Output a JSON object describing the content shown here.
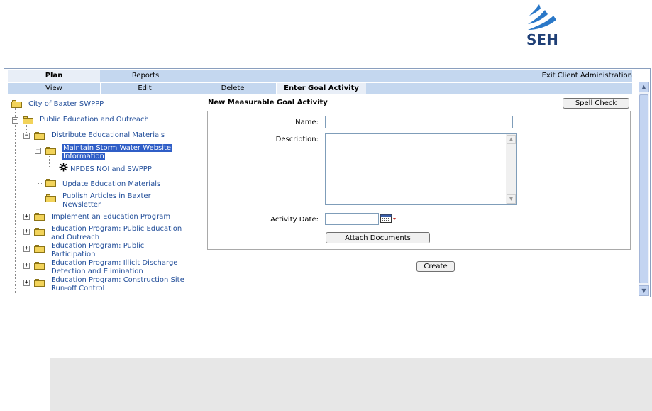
{
  "logo": {
    "text": "SEH"
  },
  "top_tabs": {
    "plan": "Plan",
    "reports": "Reports",
    "exit": "Exit Client Administration"
  },
  "sub_tabs": {
    "view": "View",
    "edit": "Edit",
    "delete": "Delete",
    "enter": "Enter Goal Activity"
  },
  "tree": {
    "root": "City of Baxter SWPPP",
    "public_ed": "Public Education and Outreach",
    "distribute": "Distribute Educational Materials",
    "maintain_1": "Maintain Storm Water Website",
    "maintain_2": "Information",
    "npdes": "NPDES NOI and SWPPP",
    "update": "Update Education Materials",
    "publish_1": "Publish Articles in Baxter",
    "publish_2": "Newsletter",
    "implement": "Implement an Education Program",
    "ep1_1": "Education Program: Public Education",
    "ep1_2": "and Outreach",
    "ep2_1": "Education Program: Public",
    "ep2_2": "Participation",
    "ep3_1": "Education Program: Illicit Discharge",
    "ep3_2": "Detection and Elimination",
    "ep4_1": "Education Program: Construction Site",
    "ep4_2": "Run-off Control"
  },
  "form": {
    "title": "New Measurable Goal Activity",
    "spell_check": "Spell Check",
    "name_label": "Name:",
    "name_value": "",
    "description_label": "Description:",
    "description_value": "",
    "date_label": "Activity Date:",
    "date_value": "",
    "attach": "Attach Documents",
    "create": "Create"
  }
}
